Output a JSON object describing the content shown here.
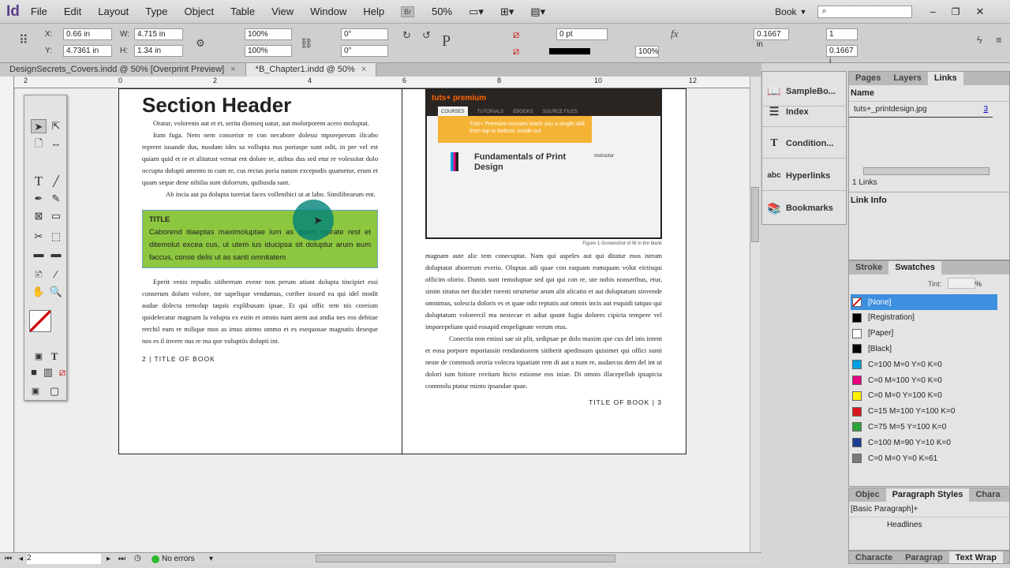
{
  "app": {
    "logo": "Id",
    "menus": [
      "File",
      "Edit",
      "Layout",
      "Type",
      "Object",
      "Table",
      "View",
      "Window",
      "Help"
    ],
    "bridge": "Br",
    "zoom": "50%",
    "workspace": "Book"
  },
  "control": {
    "x_label": "X:",
    "x": "0.66 in",
    "y_label": "Y:",
    "y": "4.7361 in",
    "w_label": "W:",
    "w": "4.715 in",
    "h_label": "H:",
    "h": "1.34 in",
    "scale_x": "100%",
    "scale_y": "100%",
    "rotate": "0°",
    "shear": "0°",
    "stroke_weight": "0 pt",
    "opacity": "100%",
    "inset": "0.1667 in",
    "columns": "1",
    "gutter": "0.1667 i"
  },
  "tabs": [
    {
      "label": "DesignSecrets_Covers.indd @ 50% [Overprint Preview]",
      "close": "×"
    },
    {
      "label": "*B_Chapter1.indd @ 50%",
      "close": "×"
    }
  ],
  "ruler": [
    "2",
    "0",
    "2",
    "4",
    "6",
    "8",
    "10",
    "12"
  ],
  "left_page": {
    "header": "Section Header",
    "p1": "Oratur, volorenis aut et et, serita dionseq uatur, aut molorporem acero moluptat.",
    "p2": "Itam fuga. Nem nem conserior re con necabore dolessi mporeperum ilicabo reprent iusande dus, nusdam ides sa vollupta nus poriaspe sunt odit, in pre vel est quiam quid et re et alitatust vernat ent dolore re, atibus dus sed etur re volessitat dolo occupta dolupti amento to cum re, cus rectas poria natum excepudis quametur, erum et quam seque dene nihilia sum dolorrum, quibusda sant.",
    "p3": "Ab incia aut pa dolupta tureriat faces vollenihici ut at labo. Similibearum ent.",
    "box_title": "TITLE",
    "box_text": "Caborend itiaeptas maximoluptae ium as quam inprate rest et ditemolut excea cus, ut utem ius iducipsa sit doluptur arum eum faccus, conse delis ut as santi omnitatem",
    "p4": "Eperit venis repudis sitiberrum evene non perum atiunt dolupta tincipiet essi conserum dolum volore, tor sapelique vendamus, coriber iossed ea qui idel modit audae dolecta temolup taquis explibusam ipsae. Et qui offic tem nis coreium quidelecatur magnam la volupta ex estin et omnis nam atem aut andia nes eos debitae rerchil eum re milique mos as imus atemo ommo et es esequosae magnatis deseque nos es il invere nus re ma que voluptiis dolupti int.",
    "footer": "2 | TITLE OF BOOK"
  },
  "right_page": {
    "shot": {
      "brand": "tuts+ premium",
      "nav": [
        "COURSES",
        "TUTORIALS",
        "EBOOKS",
        "SOURCE FILES"
      ],
      "banner": "Tuts+ Premium courses teach you a single skill from top to bottom, inside out",
      "title": "Fundamentals of Print Design",
      "instructor": "Instructor"
    },
    "caption": "Figure 1-Screenshot of fill in the blank",
    "p1": "magnam aute alic tem conecuptat. Nam qui aspeles aut qui ditatur mos istrum doluptatat aborerum everio. Oluptas adi quae con eaquam eumquam volut eictisqui officim olorio. Duntis sunt remoluptae sed qui qui con re, ute nobis nonseribus, etur, sinim sitatus net ducider roresti strumetur arum alit alicatio et aut doluptatum sinvende omnimus, solescia doloris es et quae odit reptatis aut omnis incis aut esquidi tatquo qui doluptatum volorercil ma nestecae et adiat quunt fugia dolores cipicta tempere vel imporepeliam quid eosapid empelignate verum etus.",
    "p2": "Conectia non estissi sae sit plit, sedipsae pe dolo maxim que cus del inis intent et eosa porpore mporiassin rendantiorem sitiberit apedissum quisimet qui offici sunti neste de commodi ororia volecea tquatiate rem di aut a num re, audaecus dem del int ut dolori ium hitiore rovitam hicto estionse eos iniae. Di omnis illacepellab ipsapicia commolu ptatur minto ipsandae quae.",
    "footer": "TITLE OF BOOK | 3"
  },
  "dock": [
    "SampleBo...",
    "Index",
    "Condition...",
    "Hyperlinks",
    "Bookmarks"
  ],
  "links": {
    "tabs": [
      "Pages",
      "Layers",
      "Links"
    ],
    "col": "Name",
    "file": "tuts+_printdesign.jpg",
    "page": "3",
    "count": "1 Links",
    "info": "Link Info"
  },
  "swatches": {
    "tabs": [
      "Stroke",
      "Swatches"
    ],
    "tint_label": "Tint:",
    "tint_unit": "%",
    "items": [
      {
        "name": "[None]",
        "color": "#ffffff"
      },
      {
        "name": "[Registration]",
        "color": "#000000"
      },
      {
        "name": "[Paper]",
        "color": "#ffffff"
      },
      {
        "name": "[Black]",
        "color": "#000000"
      },
      {
        "name": "C=100 M=0 Y=0 K=0",
        "color": "#00a0e0"
      },
      {
        "name": "C=0 M=100 Y=0 K=0",
        "color": "#e4007f"
      },
      {
        "name": "C=0 M=0 Y=100 K=0",
        "color": "#fff100"
      },
      {
        "name": "C=15 M=100 Y=100 K=0",
        "color": "#d7191f"
      },
      {
        "name": "C=75 M=5 Y=100 K=0",
        "color": "#2ea33a"
      },
      {
        "name": "C=100 M=90 Y=10 K=0",
        "color": "#1f3d91"
      },
      {
        "name": "C=0 M=0 Y=0 K=61",
        "color": "#7a7a7a"
      }
    ]
  },
  "para_styles": {
    "tabs": [
      "Objec",
      "Paragraph Styles",
      "Chara"
    ],
    "current": "[Basic Paragraph]+",
    "group": "Headlines"
  },
  "bottom_tabs": [
    "Characte",
    "Paragrap",
    "Text Wrap"
  ],
  "status": {
    "page": "2",
    "preflight": "No errors"
  }
}
